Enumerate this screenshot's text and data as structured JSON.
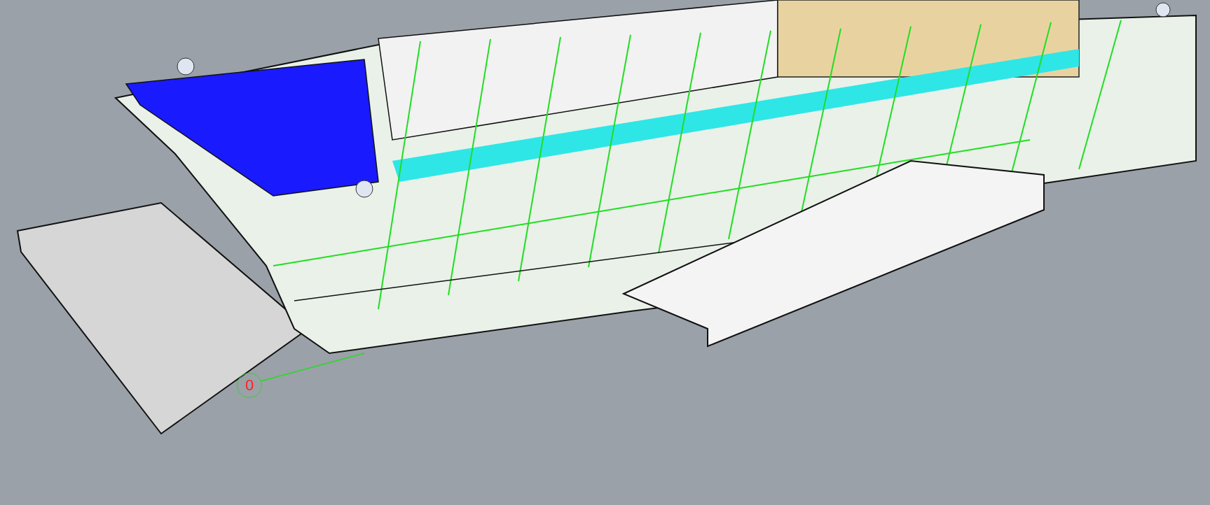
{
  "viewport": {
    "marker_label": "0"
  }
}
